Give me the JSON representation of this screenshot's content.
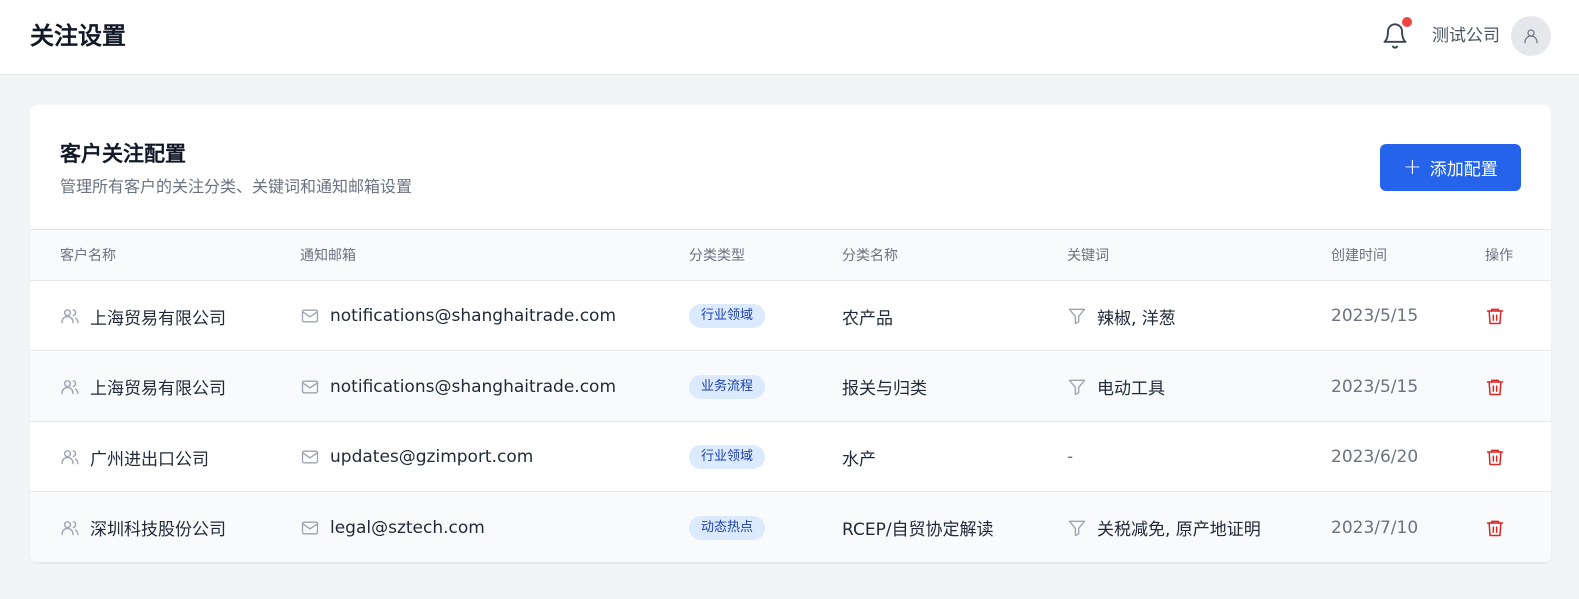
{
  "header": {
    "title": "关注设置",
    "company": "测试公司"
  },
  "card": {
    "title": "客户关注配置",
    "subtitle": "管理所有客户的关注分类、关键词和通知邮箱设置",
    "add_button": "添加配置"
  },
  "table": {
    "columns": [
      "客户名称",
      "通知邮箱",
      "分类类型",
      "分类名称",
      "关键词",
      "创建时间",
      "操作"
    ],
    "rows": [
      {
        "customer": "上海贸易有限公司",
        "email": "notifications@shanghaitrade.com",
        "type": "行业领域",
        "category": "农产品",
        "keywords": "辣椒, 洋葱",
        "has_keywords": true,
        "date": "2023/5/15"
      },
      {
        "customer": "上海贸易有限公司",
        "email": "notifications@shanghaitrade.com",
        "type": "业务流程",
        "category": "报关与归类",
        "keywords": "电动工具",
        "has_keywords": true,
        "date": "2023/5/15"
      },
      {
        "customer": "广州进出口公司",
        "email": "updates@gzimport.com",
        "type": "行业领域",
        "category": "水产",
        "keywords": "-",
        "has_keywords": false,
        "date": "2023/6/20"
      },
      {
        "customer": "深圳科技股份公司",
        "email": "legal@sztech.com",
        "type": "动态热点",
        "category": "RCEP/自贸协定解读",
        "keywords": "关税减免, 原产地证明",
        "has_keywords": true,
        "date": "2023/7/10"
      }
    ]
  },
  "colors": {
    "primary": "#2563eb",
    "danger": "#dc2626",
    "notification_dot": "#ef4444",
    "tag_bg": "#dbeafe",
    "tag_text": "#1e40af"
  },
  "icons": {
    "notification": "bell-icon",
    "user": "user-icon",
    "customer": "users-icon",
    "email": "mail-icon",
    "keywords": "filter-icon",
    "delete": "trash-icon",
    "add": "plus-icon"
  }
}
